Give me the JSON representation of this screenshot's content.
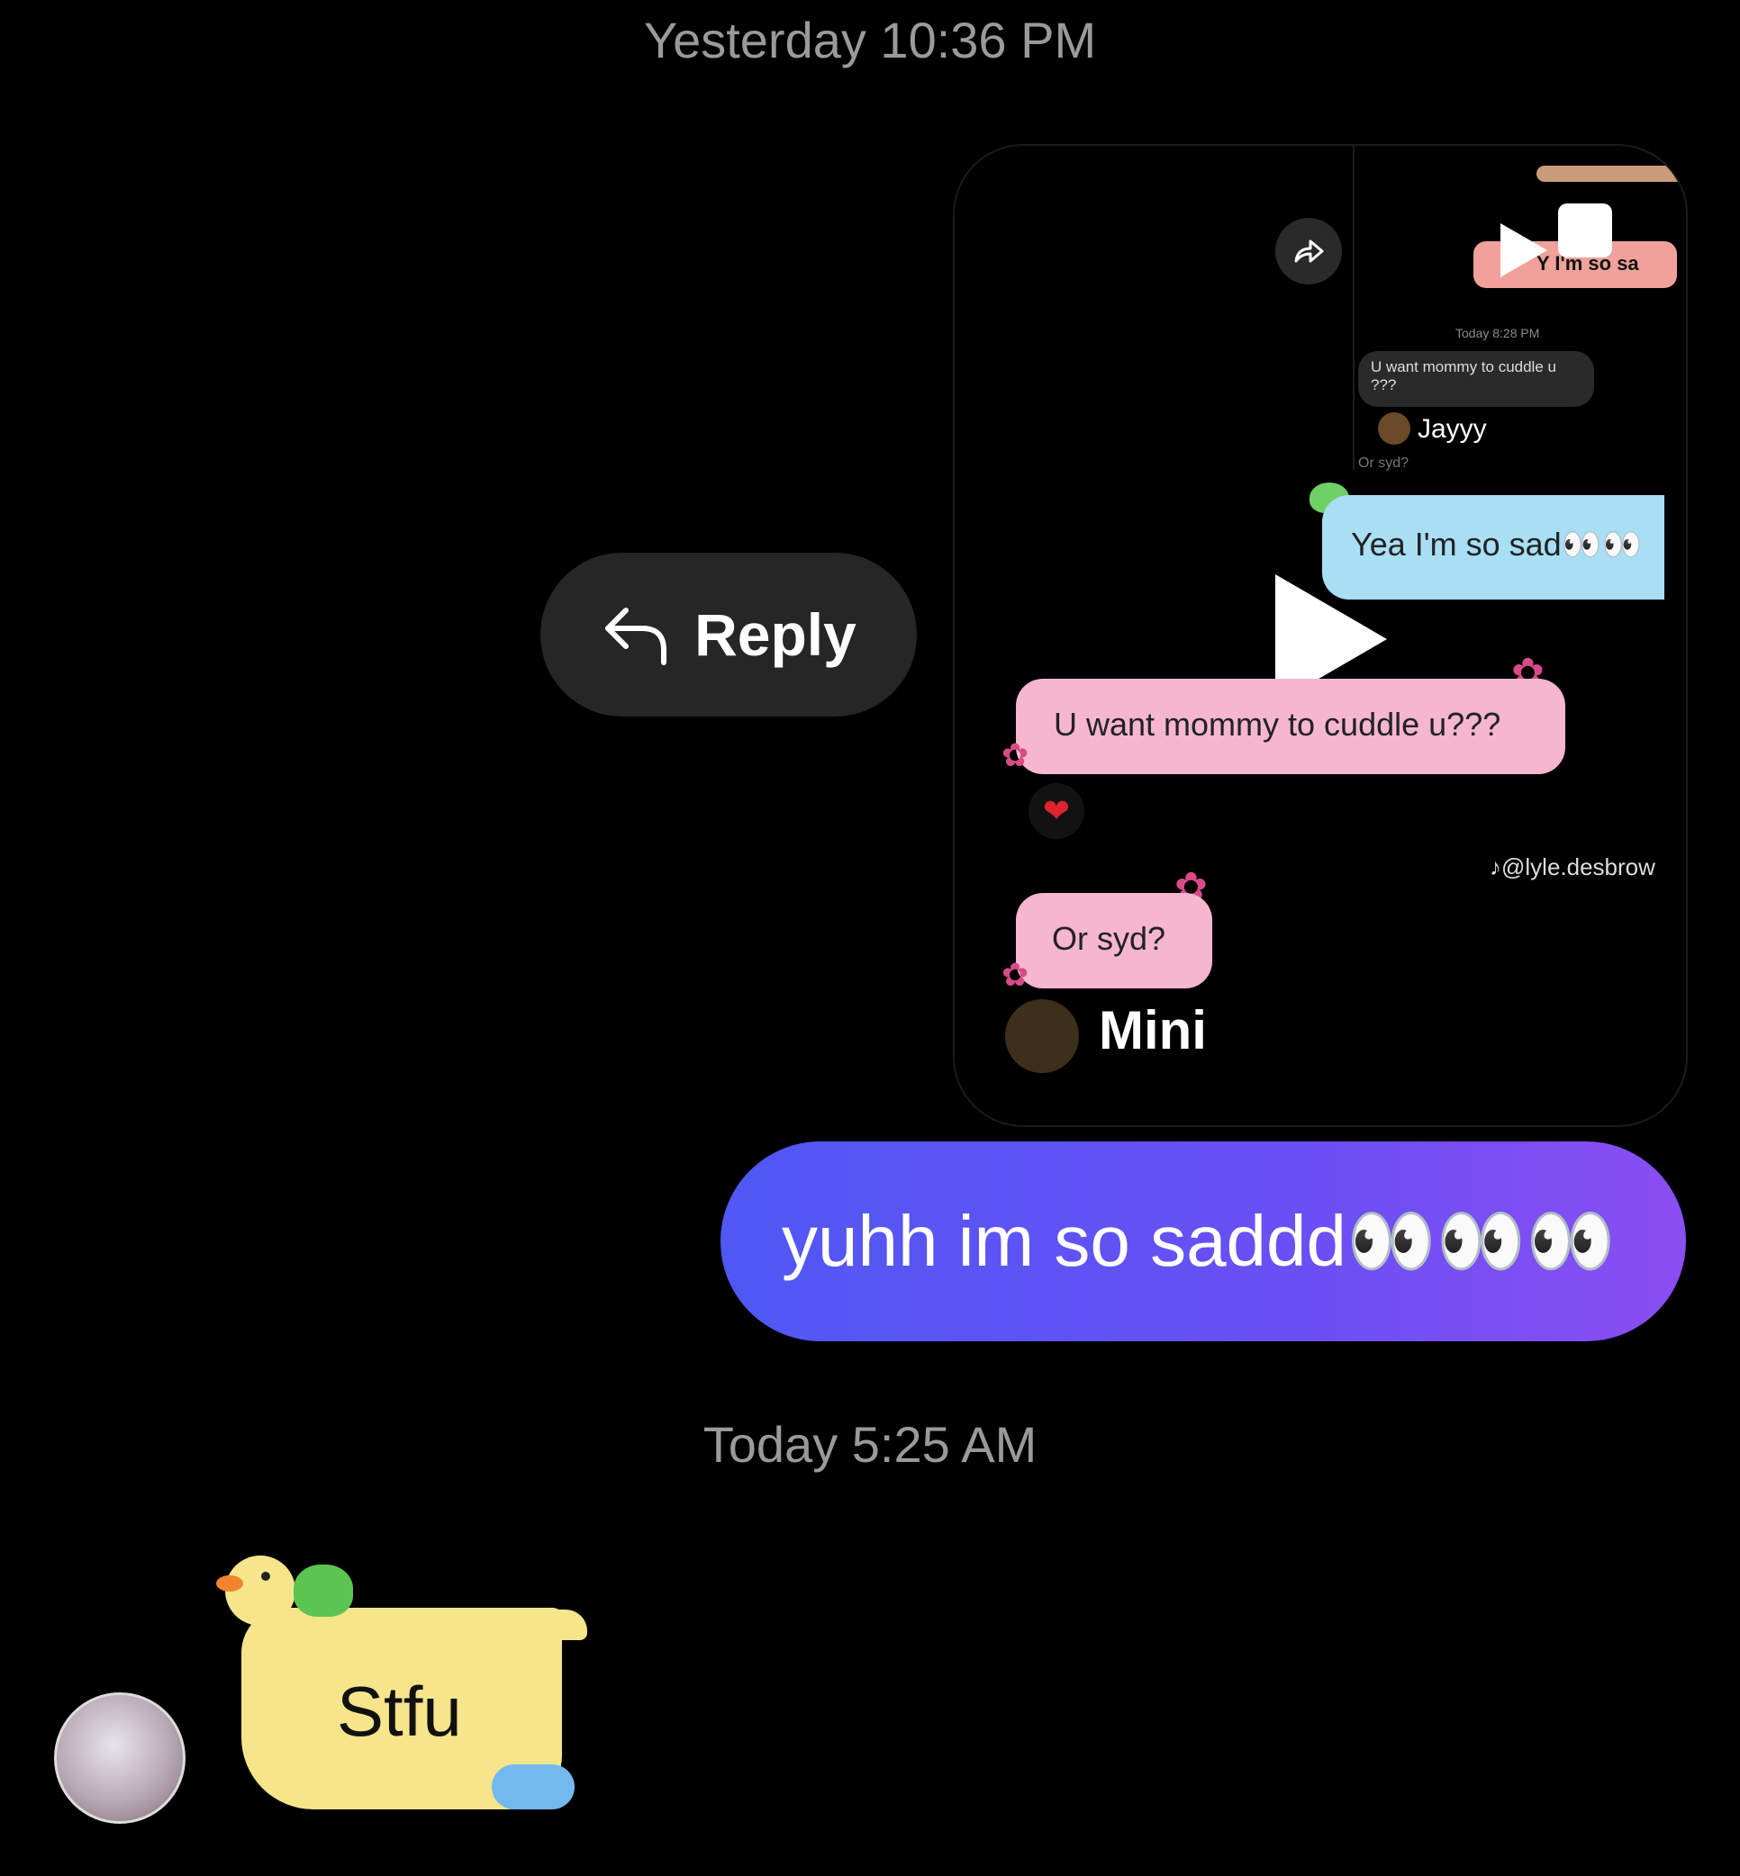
{
  "timestamps": {
    "first": "Yesterday 10:36 PM",
    "second": "Today 5:25 AM"
  },
  "reply": {
    "label": "Reply",
    "icon": "reply-arrow-icon"
  },
  "shared_video": {
    "share_icon": "share-arrow-icon",
    "inner_top_pink": "Y    I'm so sa",
    "inner_timestamp": "Today 8:28 PM",
    "inner_bubble": "U want mommy to cuddle u ???",
    "inner_name": "Jayyy",
    "inner_fragment": "Or syd?",
    "blue_bubble": "Yea I'm so sad👀👀",
    "pink_bubble": "U want mommy to cuddle u???",
    "pink_bubble_2": "Or syd?",
    "reaction": "❤",
    "watermark": "♪@lyle.desbrow",
    "profile_name": "Mini",
    "play_icon": "play-icon"
  },
  "sent_message": {
    "text": "yuhh im so saddd👀👀👀"
  },
  "received_message": {
    "text": "Stfu",
    "bubble_style": "duck-sticker",
    "colors": {
      "bubble": "#f6e58a"
    }
  },
  "colors": {
    "background": "#000000",
    "sent_gradient_start": "#4f58f3",
    "sent_gradient_end": "#8a4ef2",
    "pink_bubble": "#f6b6cf",
    "blue_bubble": "#a8dff5"
  }
}
